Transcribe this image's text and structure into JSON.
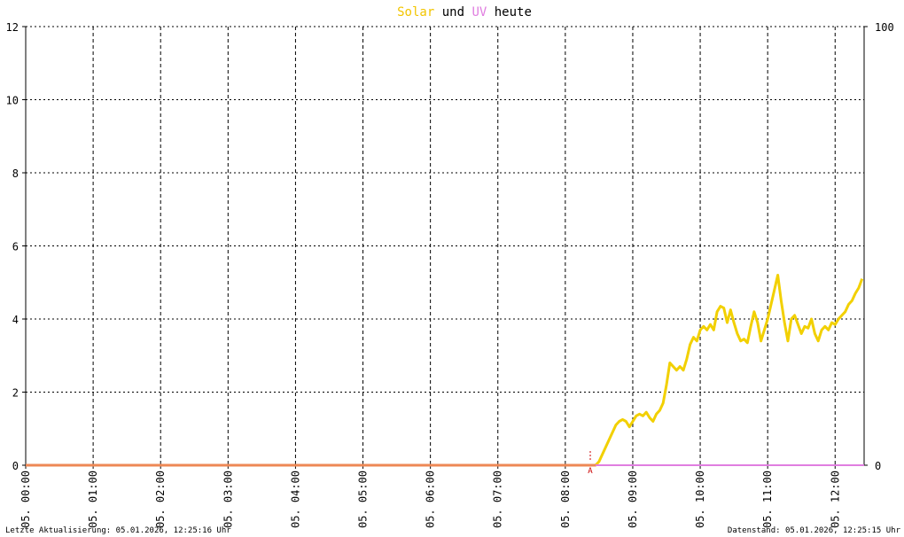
{
  "chart_data": {
    "type": "line",
    "title_parts": [
      {
        "text": "Solar",
        "color": "#f2c500"
      },
      {
        "text": " und ",
        "color": "#000000"
      },
      {
        "text": "UV",
        "color": "#e07ee0"
      },
      {
        "text": " heute",
        "color": "#000000"
      }
    ],
    "y_left": {
      "ticks": [
        0,
        2,
        4,
        6,
        8,
        10,
        12
      ],
      "min": 0,
      "max": 12
    },
    "y_right": {
      "ticks": [
        0,
        100
      ],
      "min": 0,
      "max": 100
    },
    "x_axis": {
      "start_hour": 0,
      "end_hour": 12.43,
      "tick_labels": [
        {
          "hour": 0,
          "label": "05. 00:00"
        },
        {
          "hour": 1,
          "label": "05. 01:00"
        },
        {
          "hour": 2,
          "label": "05. 02:00"
        },
        {
          "hour": 3,
          "label": "05. 03:00"
        },
        {
          "hour": 4,
          "label": "05. 04:00"
        },
        {
          "hour": 5,
          "label": "05. 05:00"
        },
        {
          "hour": 6,
          "label": "05. 06:00"
        },
        {
          "hour": 7,
          "label": "05. 07:00"
        },
        {
          "hour": 8,
          "label": "05. 08:00"
        },
        {
          "hour": 9,
          "label": "05. 09:00"
        },
        {
          "hour": 10,
          "label": "05. 10:00"
        },
        {
          "hour": 11,
          "label": "05. 11:00"
        },
        {
          "hour": 12,
          "label": "05. 12:00"
        }
      ]
    },
    "grid": true,
    "marker": {
      "hour": 8.37,
      "label": "A",
      "color": "#cc0000"
    },
    "series": [
      {
        "name": "Solar",
        "color": "#f2d000",
        "axis": "left",
        "points": [
          [
            0,
            0
          ],
          [
            8.45,
            0
          ],
          [
            8.5,
            0.1
          ],
          [
            8.55,
            0.3
          ],
          [
            8.6,
            0.5
          ],
          [
            8.65,
            0.7
          ],
          [
            8.7,
            0.9
          ],
          [
            8.75,
            1.1
          ],
          [
            8.8,
            1.2
          ],
          [
            8.85,
            1.25
          ],
          [
            8.9,
            1.2
          ],
          [
            8.95,
            1.05
          ],
          [
            9.0,
            1.2
          ],
          [
            9.05,
            1.35
          ],
          [
            9.1,
            1.4
          ],
          [
            9.15,
            1.35
          ],
          [
            9.2,
            1.45
          ],
          [
            9.25,
            1.3
          ],
          [
            9.3,
            1.2
          ],
          [
            9.35,
            1.4
          ],
          [
            9.4,
            1.5
          ],
          [
            9.45,
            1.7
          ],
          [
            9.5,
            2.2
          ],
          [
            9.55,
            2.8
          ],
          [
            9.6,
            2.7
          ],
          [
            9.65,
            2.6
          ],
          [
            9.7,
            2.7
          ],
          [
            9.75,
            2.6
          ],
          [
            9.8,
            2.9
          ],
          [
            9.85,
            3.3
          ],
          [
            9.9,
            3.5
          ],
          [
            9.95,
            3.4
          ],
          [
            10.0,
            3.7
          ],
          [
            10.05,
            3.8
          ],
          [
            10.1,
            3.7
          ],
          [
            10.15,
            3.85
          ],
          [
            10.2,
            3.7
          ],
          [
            10.25,
            4.2
          ],
          [
            10.3,
            4.35
          ],
          [
            10.35,
            4.3
          ],
          [
            10.4,
            3.9
          ],
          [
            10.45,
            4.25
          ],
          [
            10.5,
            3.9
          ],
          [
            10.55,
            3.6
          ],
          [
            10.6,
            3.4
          ],
          [
            10.65,
            3.45
          ],
          [
            10.7,
            3.35
          ],
          [
            10.75,
            3.8
          ],
          [
            10.8,
            4.2
          ],
          [
            10.85,
            3.9
          ],
          [
            10.9,
            3.4
          ],
          [
            10.95,
            3.7
          ],
          [
            11.0,
            4.0
          ],
          [
            11.05,
            4.4
          ],
          [
            11.1,
            4.8
          ],
          [
            11.15,
            5.2
          ],
          [
            11.2,
            4.5
          ],
          [
            11.25,
            3.9
          ],
          [
            11.3,
            3.4
          ],
          [
            11.35,
            4.0
          ],
          [
            11.4,
            4.1
          ],
          [
            11.45,
            3.85
          ],
          [
            11.5,
            3.6
          ],
          [
            11.55,
            3.8
          ],
          [
            11.6,
            3.75
          ],
          [
            11.65,
            4.0
          ],
          [
            11.7,
            3.6
          ],
          [
            11.75,
            3.4
          ],
          [
            11.8,
            3.7
          ],
          [
            11.85,
            3.8
          ],
          [
            11.9,
            3.7
          ],
          [
            11.95,
            3.9
          ],
          [
            12.0,
            3.85
          ],
          [
            12.05,
            4.0
          ],
          [
            12.1,
            4.1
          ],
          [
            12.15,
            4.2
          ],
          [
            12.2,
            4.4
          ],
          [
            12.25,
            4.5
          ],
          [
            12.3,
            4.7
          ],
          [
            12.35,
            4.85
          ],
          [
            12.4,
            5.1
          ]
        ]
      },
      {
        "name": "UV",
        "color": "#e07ee0",
        "axis": "right",
        "points": [
          [
            0,
            0
          ],
          [
            12.43,
            0
          ]
        ]
      }
    ],
    "baseline_segment": {
      "color": "#ee8855",
      "from_hour": 0,
      "to_hour": 8.45,
      "value": 0
    }
  },
  "footer": {
    "left": "Letzte Aktualisierung: 05.01.2026, 12:25:16 Uhr",
    "right": "Datenstand: 05.01.2026, 12:25:15 Uhr"
  }
}
